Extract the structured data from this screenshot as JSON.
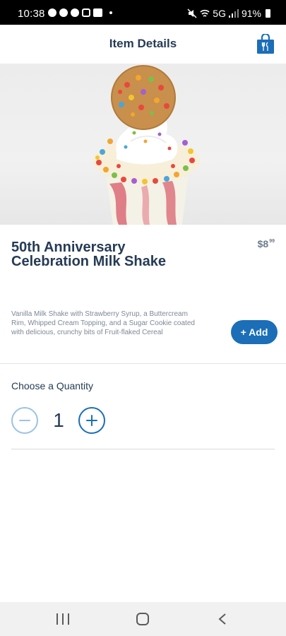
{
  "status_bar": {
    "time": "10:38",
    "network": "5G",
    "battery": "91%"
  },
  "header": {
    "title": "Item Details",
    "bag_icon": "shopping-bag-icon"
  },
  "item": {
    "title": "50th Anniversary Celebration Milk Shake",
    "price_dollars": "$8",
    "price_cents": "99",
    "description": "Vanilla Milk Shake with Strawberry Syrup, a Buttercream Rim, Whipped Cream Topping, and a Sugar Cookie coated with delicious, crunchy bits of Fruit-flaked Cereal",
    "add_label": "+ Add"
  },
  "quantity": {
    "label": "Choose a Quantity",
    "value": "1"
  },
  "colors": {
    "primary": "#1b6eb7",
    "text": "#253b56"
  }
}
